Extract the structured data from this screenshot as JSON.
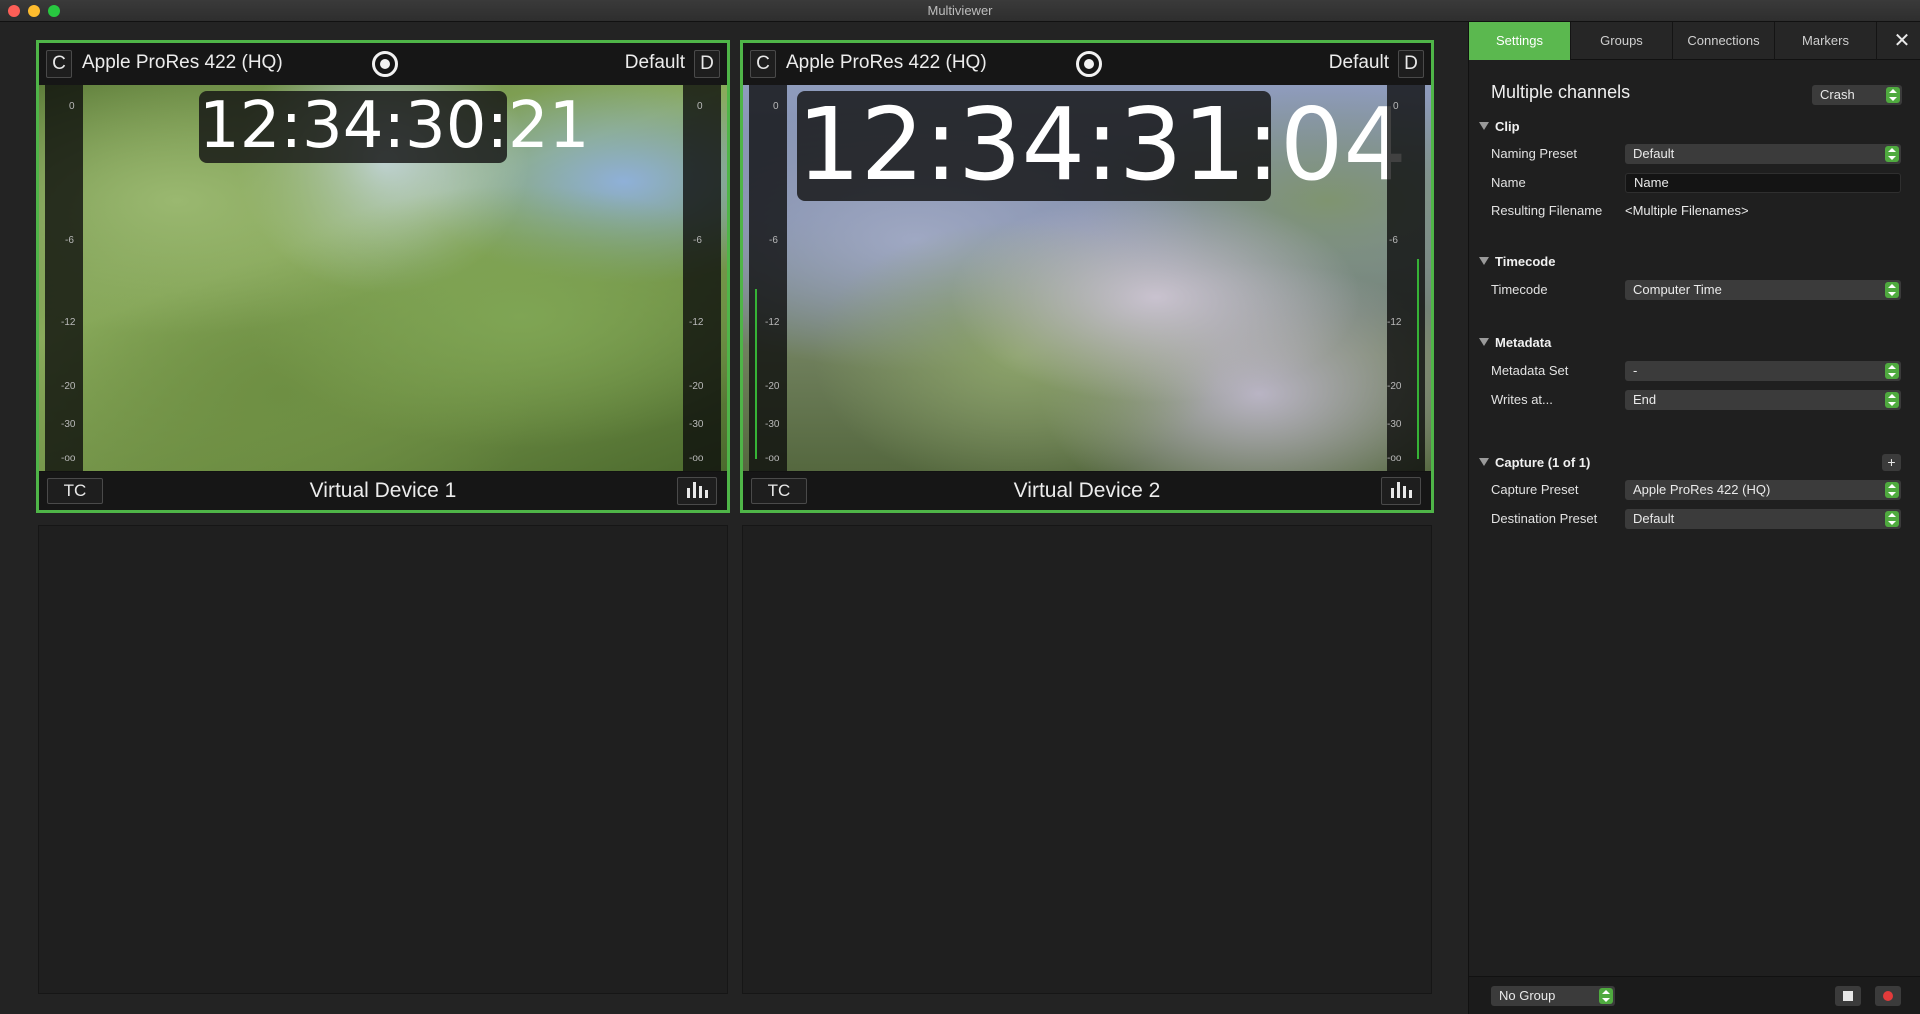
{
  "window": {
    "title": "Multiviewer"
  },
  "tiles": [
    {
      "left_badge": "C",
      "codec": "Apple ProRes 422 (HQ)",
      "preset": "Default",
      "right_badge": "D",
      "timecode": "12:34:30:21",
      "footer_tc": "TC",
      "device_name": "Virtual Device 1",
      "meter_ticks": [
        "0",
        "-6",
        "-12",
        "-20",
        "-30",
        "-oo"
      ]
    },
    {
      "left_badge": "C",
      "codec": "Apple ProRes 422 (HQ)",
      "preset": "Default",
      "right_badge": "D",
      "timecode": "12:34:31:04",
      "footer_tc": "TC",
      "device_name": "Virtual Device 2",
      "meter_ticks": [
        "0",
        "-6",
        "-12",
        "-20",
        "-30",
        "-oo"
      ]
    }
  ],
  "sidebar": {
    "tabs": [
      "Settings",
      "Groups",
      "Connections",
      "Markers"
    ],
    "selected_tab": "Settings",
    "panel_title": "Multiple channels",
    "mode_select": "Crash",
    "clip": {
      "section": "Clip",
      "naming_preset_label": "Naming Preset",
      "naming_preset_value": "Default",
      "name_label": "Name",
      "name_value": "Name",
      "resulting_filename_label": "Resulting Filename",
      "resulting_filename_value": "<Multiple Filenames>"
    },
    "timecode": {
      "section": "Timecode",
      "label": "Timecode",
      "value": "Computer Time"
    },
    "metadata": {
      "section": "Metadata",
      "set_label": "Metadata Set",
      "set_value": "-",
      "writes_label": "Writes at...",
      "writes_value": "End"
    },
    "capture": {
      "section": "Capture (1 of 1)",
      "add_label": "+",
      "preset_label": "Capture Preset",
      "preset_value": "Apple ProRes 422 (HQ)",
      "destination_label": "Destination Preset",
      "destination_value": "Default"
    },
    "footer": {
      "group_select": "No Group"
    }
  },
  "colors": {
    "accent_green": "#4fb548",
    "record_red": "#e23b3b"
  }
}
